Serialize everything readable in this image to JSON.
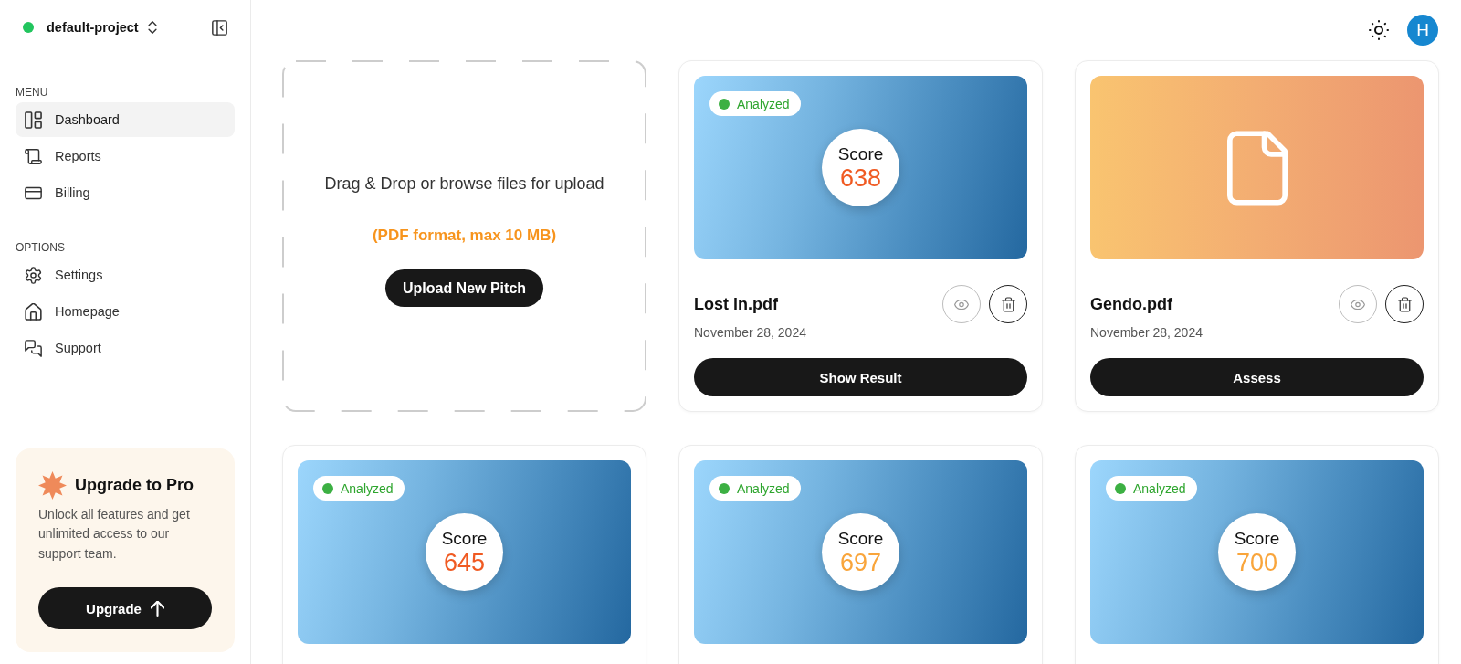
{
  "sidebar": {
    "project": {
      "name": "default-project"
    },
    "sections": [
      {
        "label": "MENU",
        "items": [
          {
            "label": "Dashboard",
            "selected": true
          },
          {
            "label": "Reports",
            "selected": false
          },
          {
            "label": "Billing",
            "selected": false
          }
        ]
      },
      {
        "label": "OPTIONS",
        "items": [
          {
            "label": "Settings",
            "selected": false
          },
          {
            "label": "Homepage",
            "selected": false
          },
          {
            "label": "Support",
            "selected": false
          }
        ]
      }
    ],
    "promo": {
      "title": "Upgrade to Pro",
      "text": "Unlock all features and get unlimited access to our support team.",
      "button": "Upgrade"
    }
  },
  "header": {
    "avatar": "H"
  },
  "upload": {
    "title": "Drag & Drop or browse files for upload",
    "hint": "(PDF format, max 10 MB)",
    "button": "Upload New Pitch"
  },
  "cards": [
    {
      "kind": "analyzed",
      "status": "Analyzed",
      "score_label": "Score",
      "score": "638",
      "color": "#f05a22",
      "title": "Lost in.pdf",
      "date": "November 28, 2024",
      "button": "Show Result"
    },
    {
      "kind": "pending",
      "title": "Gendo.pdf",
      "date": "November 28, 2024",
      "button": "Assess"
    },
    {
      "kind": "analyzed",
      "status": "Analyzed",
      "score_label": "Score",
      "score": "645",
      "color": "#f05a22"
    },
    {
      "kind": "analyzed",
      "status": "Analyzed",
      "score_label": "Score",
      "score": "697",
      "color": "#f9a53b"
    },
    {
      "kind": "analyzed",
      "status": "Analyzed",
      "score_label": "Score",
      "score": "700",
      "color": "#f9a53b"
    }
  ]
}
